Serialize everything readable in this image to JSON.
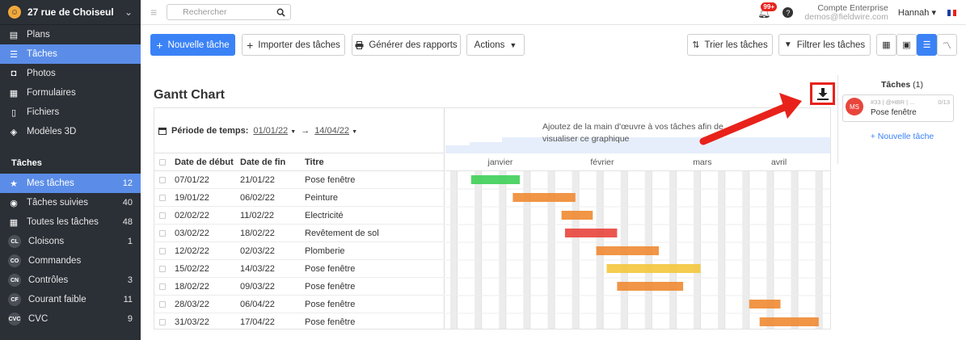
{
  "sidebar": {
    "project_name": "27 rue de Choiseul",
    "nav": [
      {
        "label": "Plans",
        "icon": "plans-icon",
        "glyph": "▤"
      },
      {
        "label": "Tâches",
        "icon": "tasks-icon",
        "glyph": "☰",
        "active": true
      },
      {
        "label": "Photos",
        "icon": "camera-icon",
        "glyph": "◘"
      },
      {
        "label": "Formulaires",
        "icon": "form-icon",
        "glyph": "▦"
      },
      {
        "label": "Fichiers",
        "icon": "file-icon",
        "glyph": "▯"
      },
      {
        "label": "Modèles 3D",
        "icon": "cube-icon",
        "glyph": "◈"
      }
    ],
    "section_title": "Tâches",
    "task_items": [
      {
        "label": "Mes tâches",
        "count": "12",
        "icon": "star-icon",
        "glyph": "★",
        "active": true
      },
      {
        "label": "Tâches suivies",
        "count": "40",
        "icon": "eye-icon",
        "glyph": "◉"
      },
      {
        "label": "Toutes les tâches",
        "count": "48",
        "icon": "grid-icon",
        "glyph": "▦"
      },
      {
        "label": "Cloisons",
        "count": "1",
        "circle": "CL"
      },
      {
        "label": "Commandes",
        "count": "",
        "circle": "CO"
      },
      {
        "label": "Contrôles",
        "count": "3",
        "circle": "CN"
      },
      {
        "label": "Courant faible",
        "count": "11",
        "circle": "CF"
      },
      {
        "label": "CVC",
        "count": "9",
        "circle": "CVC"
      }
    ]
  },
  "topbar": {
    "search_placeholder": "Rechercher",
    "notif_count": "99+",
    "account_title": "Compte Enterprise",
    "account_email": "demos@fieldwire.com",
    "user_name": "Hannah"
  },
  "toolbar": {
    "new_task": "Nouvelle tâche",
    "import": "Importer des tâches",
    "reports": "Générer des rapports",
    "actions": "Actions",
    "sort": "Trier les tâches",
    "filter": "Filtrer les tâches"
  },
  "gantt": {
    "title": "Gantt Chart",
    "period_label": "Période de temps:",
    "period_start": "01/01/22",
    "period_end": "14/04/22",
    "columns": [
      "Date de début",
      "Date de fin",
      "Titre"
    ],
    "overview_message": "Ajoutez de la main d'œuvre à vos tâches afin de visualiser ce graphique",
    "months": [
      "janvier",
      "février",
      "mars",
      "avril"
    ],
    "rows": [
      {
        "start": "07/01/22",
        "end": "21/01/22",
        "title": "Pose fenêtre",
        "color": "#3ecf58"
      },
      {
        "start": "19/01/22",
        "end": "06/02/22",
        "title": "Peinture",
        "color": "#f08a32"
      },
      {
        "start": "02/02/22",
        "end": "11/02/22",
        "title": "Electricité",
        "color": "#f08a32"
      },
      {
        "start": "03/02/22",
        "end": "18/02/22",
        "title": "Revêtement de sol",
        "color": "#e8453c"
      },
      {
        "start": "12/02/22",
        "end": "02/03/22",
        "title": "Plomberie",
        "color": "#f08a32"
      },
      {
        "start": "15/02/22",
        "end": "14/03/22",
        "title": "Pose fenêtre",
        "color": "#f4c63c"
      },
      {
        "start": "18/02/22",
        "end": "09/03/22",
        "title": "Pose fenêtre",
        "color": "#f08a32"
      },
      {
        "start": "28/03/22",
        "end": "06/04/22",
        "title": "Pose fenêtre",
        "color": "#f08a32"
      },
      {
        "start": "31/03/22",
        "end": "17/04/22",
        "title": "Pose fenêtre",
        "color": "#f08a32"
      }
    ]
  },
  "side_panel": {
    "title": "Tâches",
    "count": "(1)",
    "card_initials": "MS",
    "card_meta": "#33 | @HBR | ...",
    "card_count": "0/13",
    "card_title": "Pose fenêtre",
    "add_label": "+ Nouvelle tâche"
  },
  "colors": {
    "accent": "#3b82f6",
    "highlight": "#e8221b",
    "sidebar": "#2b2f36"
  }
}
